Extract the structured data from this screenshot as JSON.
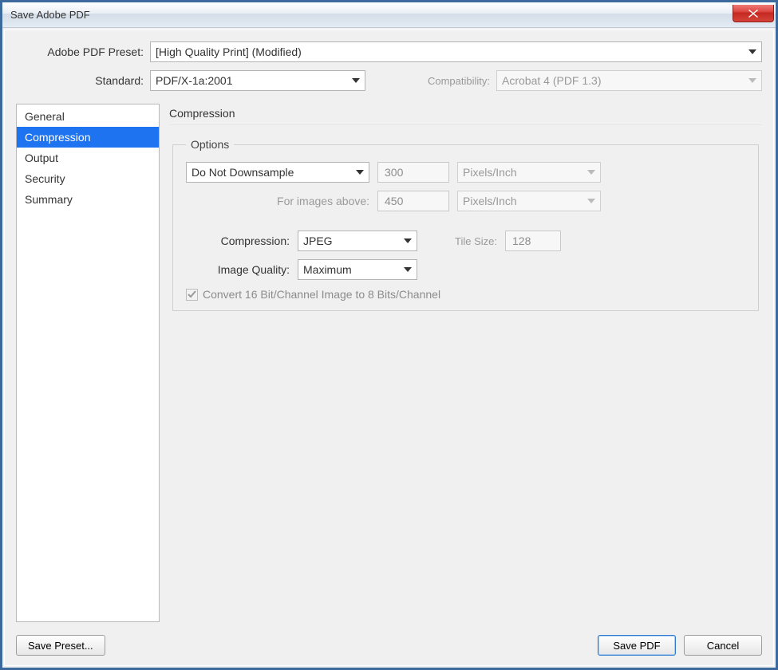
{
  "window": {
    "title": "Save Adobe PDF"
  },
  "header": {
    "preset_label": "Adobe PDF Preset:",
    "preset_value": "[High Quality Print] (Modified)",
    "standard_label": "Standard:",
    "standard_value": "PDF/X-1a:2001",
    "compat_label": "Compatibility:",
    "compat_value": "Acrobat 4 (PDF 1.3)"
  },
  "sidebar": {
    "items": [
      {
        "label": "General"
      },
      {
        "label": "Compression"
      },
      {
        "label": "Output"
      },
      {
        "label": "Security"
      },
      {
        "label": "Summary"
      }
    ],
    "selected_index": 1
  },
  "panel": {
    "title": "Compression",
    "options_legend": "Options",
    "downsample_value": "Do Not Downsample",
    "resolution_value": "300",
    "resolution_unit": "Pixels/Inch",
    "above_label": "For images above:",
    "above_value": "450",
    "above_unit": "Pixels/Inch",
    "compression_label": "Compression:",
    "compression_value": "JPEG",
    "tile_label": "Tile Size:",
    "tile_value": "128",
    "quality_label": "Image Quality:",
    "quality_value": "Maximum",
    "convert16_label": "Convert 16 Bit/Channel Image to 8 Bits/Channel"
  },
  "footer": {
    "save_preset": "Save Preset...",
    "save_pdf": "Save PDF",
    "cancel": "Cancel"
  }
}
